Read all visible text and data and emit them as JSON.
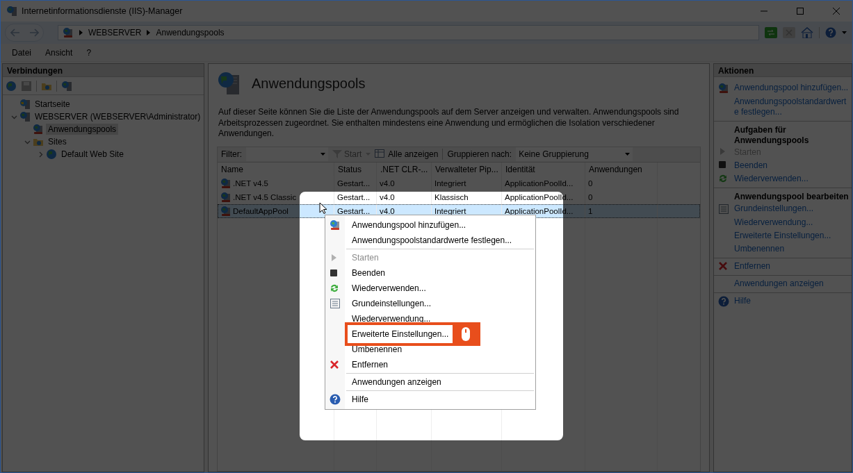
{
  "window": {
    "title": "Internetinformationsdienste (IIS)-Manager"
  },
  "address": {
    "crumbs": [
      "WEBSERVER",
      "Anwendungspools"
    ]
  },
  "menu": [
    "Datei",
    "Ansicht",
    "?"
  ],
  "connections": {
    "title": "Verbindungen",
    "tree": [
      {
        "label": "Startseite",
        "kind": "home",
        "selected": false
      },
      {
        "label": "WEBSERVER (WEBSERVER\\Administrator)",
        "kind": "server",
        "selected": false,
        "expanded": true,
        "children": [
          {
            "label": "Anwendungspools",
            "kind": "pool",
            "selected": true
          },
          {
            "label": "Sites",
            "kind": "folder",
            "selected": false,
            "expanded": true,
            "children": [
              {
                "label": "Default Web Site",
                "kind": "site",
                "selected": false,
                "expanded": false
              }
            ]
          }
        ]
      }
    ]
  },
  "page": {
    "title": "Anwendungspools",
    "description": "Auf dieser Seite können Sie die Liste der Anwendungspools auf dem Server anzeigen und verwalten. Anwendungspools sind Arbeitsprozessen zugeordnet. Sie enthalten mindestens eine Anwendung und ermöglichen die Isolation verschiedener Anwendungen.",
    "toolbar": {
      "filter_label": "Filter:",
      "start": "Start",
      "show_all": "Alle anzeigen",
      "group_label": "Gruppieren nach:",
      "group_value": "Keine Gruppierung"
    },
    "table": {
      "columns": [
        "Name",
        "Status",
        ".NET CLR-...",
        "Verwalteter Pip...",
        "Identität",
        "Anwendungen"
      ],
      "rows": [
        {
          "selected": false,
          "cells": [
            ".NET v4.5",
            "Gestart...",
            "v4.0",
            "Integriert",
            "ApplicationPoolId...",
            "0"
          ]
        },
        {
          "selected": false,
          "cells": [
            ".NET v4.5 Classic",
            "Gestart...",
            "v4.0",
            "Klassisch",
            "ApplicationPoolId...",
            "0"
          ]
        },
        {
          "selected": true,
          "cells": [
            "DefaultAppPool",
            "Gestart...",
            "v4.0",
            "Integriert",
            "ApplicationPoolId...",
            "1"
          ]
        }
      ]
    }
  },
  "actions": {
    "title": "Aktionen",
    "groups": [
      {
        "items": [
          {
            "label": "Anwendungspool hinzufügen...",
            "kind": "add",
            "disabled": false
          },
          {
            "label": "Anwendungspoolstandardwerte festlegen...",
            "kind": "plain",
            "disabled": false
          }
        ]
      },
      {
        "heading": "Aufgaben für Anwendungspools",
        "items": [
          {
            "label": "Starten",
            "kind": "start",
            "disabled": true
          },
          {
            "label": "Beenden",
            "kind": "stop",
            "disabled": false
          },
          {
            "label": "Wiederverwenden...",
            "kind": "recycle",
            "disabled": false
          }
        ]
      },
      {
        "heading": "Anwendungspool bearbeiten",
        "items": [
          {
            "label": "Grundeinstellungen...",
            "kind": "settings",
            "disabled": false
          },
          {
            "label": "Wiederverwendung...",
            "kind": "plain",
            "disabled": false
          },
          {
            "label": "Erweiterte Einstellungen...",
            "kind": "plain",
            "disabled": false
          },
          {
            "label": "Umbenennen",
            "kind": "plain",
            "disabled": false
          }
        ]
      },
      {
        "items": [
          {
            "label": "Entfernen",
            "kind": "remove",
            "disabled": false
          }
        ]
      },
      {
        "items": [
          {
            "label": "Anwendungen anzeigen",
            "kind": "plain",
            "disabled": false
          }
        ]
      },
      {
        "items": [
          {
            "label": "Hilfe",
            "kind": "help",
            "disabled": false
          }
        ]
      }
    ]
  },
  "context_menu": {
    "groups": [
      {
        "items": [
          {
            "label": "Anwendungspool hinzufügen...",
            "kind": "add",
            "disabled": false,
            "highlighted": false
          },
          {
            "label": "Anwendungspoolstandardwerte festlegen...",
            "kind": "plain",
            "disabled": false,
            "highlighted": false
          }
        ]
      },
      {
        "items": [
          {
            "label": "Starten",
            "kind": "start",
            "disabled": true,
            "highlighted": false
          },
          {
            "label": "Beenden",
            "kind": "stop",
            "disabled": false,
            "highlighted": false
          },
          {
            "label": "Wiederverwenden...",
            "kind": "recycle",
            "disabled": false,
            "highlighted": false
          },
          {
            "label": "Grundeinstellungen...",
            "kind": "settings",
            "disabled": false,
            "highlighted": false
          },
          {
            "label": "Wiederverwendung...",
            "kind": "plain",
            "disabled": false,
            "highlighted": false
          },
          {
            "label": "Erweiterte Einstellungen...",
            "kind": "plain",
            "disabled": false,
            "highlighted": true
          },
          {
            "label": "Umbenennen",
            "kind": "plain",
            "disabled": false,
            "highlighted": false
          },
          {
            "label": "Entfernen",
            "kind": "remove",
            "disabled": false,
            "highlighted": false
          }
        ]
      },
      {
        "items": [
          {
            "label": "Anwendungen anzeigen",
            "kind": "plain",
            "disabled": false,
            "highlighted": false
          }
        ]
      },
      {
        "items": [
          {
            "label": "Hilfe",
            "kind": "help",
            "disabled": false,
            "highlighted": false
          }
        ]
      }
    ]
  }
}
